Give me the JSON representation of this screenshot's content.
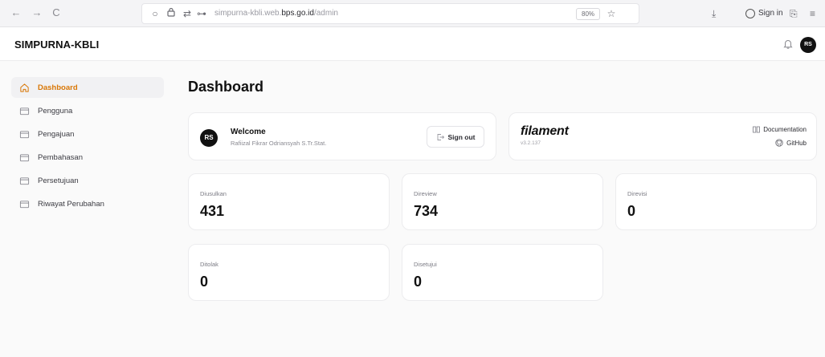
{
  "browser": {
    "url_prefix": "simpurna-kbli.web.",
    "url_domain": "bps.go.id",
    "url_path": "/admin",
    "zoom": "80%",
    "signin_label": "Sign in"
  },
  "header": {
    "brand": "SIMPURNA-KBLI",
    "avatar_initials": "RS"
  },
  "sidebar": {
    "items": [
      {
        "label": "Dashboard",
        "icon": "home-icon",
        "active": true
      },
      {
        "label": "Pengguna",
        "icon": "folder-icon"
      },
      {
        "label": "Pengajuan",
        "icon": "folder-icon"
      },
      {
        "label": "Pembahasan",
        "icon": "folder-icon"
      },
      {
        "label": "Persetujuan",
        "icon": "folder-icon"
      },
      {
        "label": "Riwayat Perubahan",
        "icon": "folder-icon"
      }
    ]
  },
  "main": {
    "title": "Dashboard",
    "welcome": {
      "avatar_initials": "RS",
      "title": "Welcome",
      "name": "Rafiizal Fikrar Odriansyah S.Tr.Stat.",
      "signout_label": "Sign out"
    },
    "filament": {
      "logo": "filament",
      "version": "v3.2.137",
      "documentation_label": "Documentation",
      "github_label": "GitHub"
    },
    "stats": [
      {
        "label": "Diusulkan",
        "value": "431"
      },
      {
        "label": "Direview",
        "value": "734"
      },
      {
        "label": "Direvisi",
        "value": "0"
      },
      {
        "label": "Ditolak",
        "value": "0"
      },
      {
        "label": "Disetujui",
        "value": "0"
      }
    ]
  },
  "colors": {
    "accent": "#d97706",
    "avatar_bg": "#111111"
  }
}
